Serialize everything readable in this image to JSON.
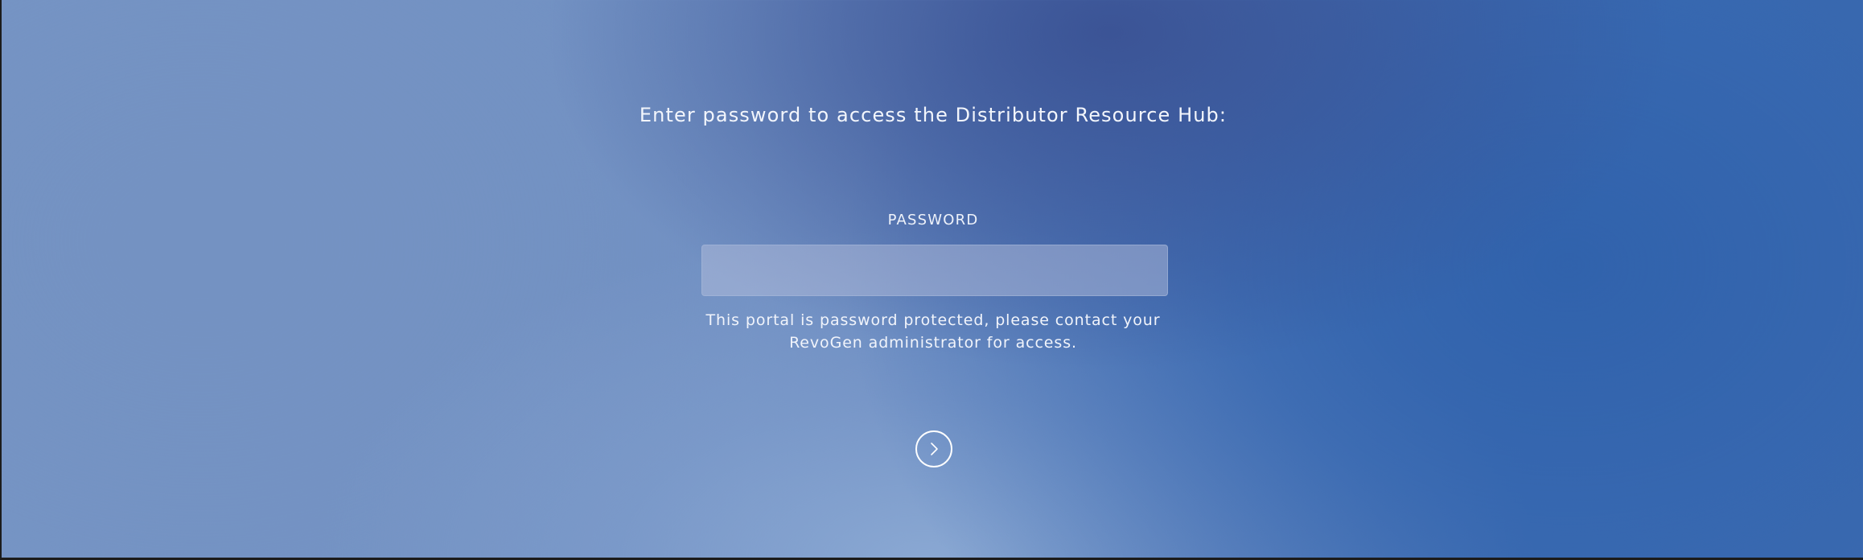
{
  "prompt": {
    "heading": "Enter password to access the Distributor Resource Hub:"
  },
  "password_field": {
    "label": "PASSWORD",
    "value": "",
    "placeholder": ""
  },
  "help": {
    "line1": "This portal is password protected, please contact your",
    "line2": "RevoGen administrator for access."
  },
  "submit": {
    "icon": "chevron-right-icon"
  },
  "colors": {
    "text": "#ffffff",
    "background_light": "#7796c6",
    "background_dark": "#3d6aae"
  }
}
